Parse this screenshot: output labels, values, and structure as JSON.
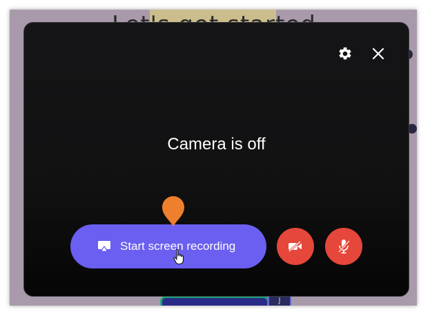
{
  "background": {
    "title": "Let's get started",
    "badge": "J"
  },
  "dialog": {
    "status_text": "Camera is off",
    "record_button_label": "Start screen recording"
  },
  "icons": {
    "settings": "gear-icon",
    "close": "close-icon",
    "screen": "screen-share-icon",
    "camera": "camera-off-icon",
    "mic": "mic-off-icon",
    "pin": "location-pin-icon",
    "cursor": "hand-pointer-icon"
  },
  "colors": {
    "accent": "#6a5ff0",
    "danger": "#e5473a",
    "pin": "#ee7f2d",
    "dialog_bg": "#111112"
  }
}
